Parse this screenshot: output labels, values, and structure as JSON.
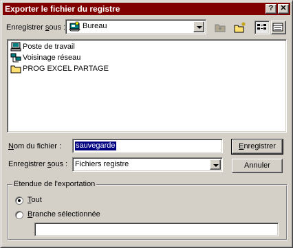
{
  "window": {
    "title": "Exporter le fichier du registre",
    "help_glyph": "?",
    "close_glyph": "✕"
  },
  "lookin": {
    "label_pre": "Enregistrer ",
    "label_accel": "s",
    "label_post": "ous :",
    "value": "Bureau",
    "icon": "desktop-icon"
  },
  "toolbar": {
    "up_icon": "folder-up-icon",
    "new_folder_icon": "new-folder-icon",
    "list_view_icon": "list-view-icon",
    "details_view_icon": "details-view-icon"
  },
  "file_list": [
    {
      "label": "Poste de travail",
      "icon": "my-computer-icon"
    },
    {
      "label": "Voisinage réseau",
      "icon": "network-neighborhood-icon"
    },
    {
      "label": "PROG EXCEL PARTAGE",
      "icon": "folder-icon"
    }
  ],
  "filename": {
    "label_accel": "N",
    "label_post": "om du fichier :",
    "value": "sauvegarde"
  },
  "filetype": {
    "label_pre": "Enregistrer ",
    "label_accel": "s",
    "label_post": "ous :",
    "value": "Fichiers registre"
  },
  "buttons": {
    "save_accel": "E",
    "save_post": "nregistrer",
    "cancel": "Annuler"
  },
  "export_range": {
    "legend": "Etendue de l'exportation",
    "all_accel": "T",
    "all_post": "out",
    "branch_accel": "B",
    "branch_post": "ranche sélectionnée",
    "selected": "all",
    "branch_value": ""
  }
}
